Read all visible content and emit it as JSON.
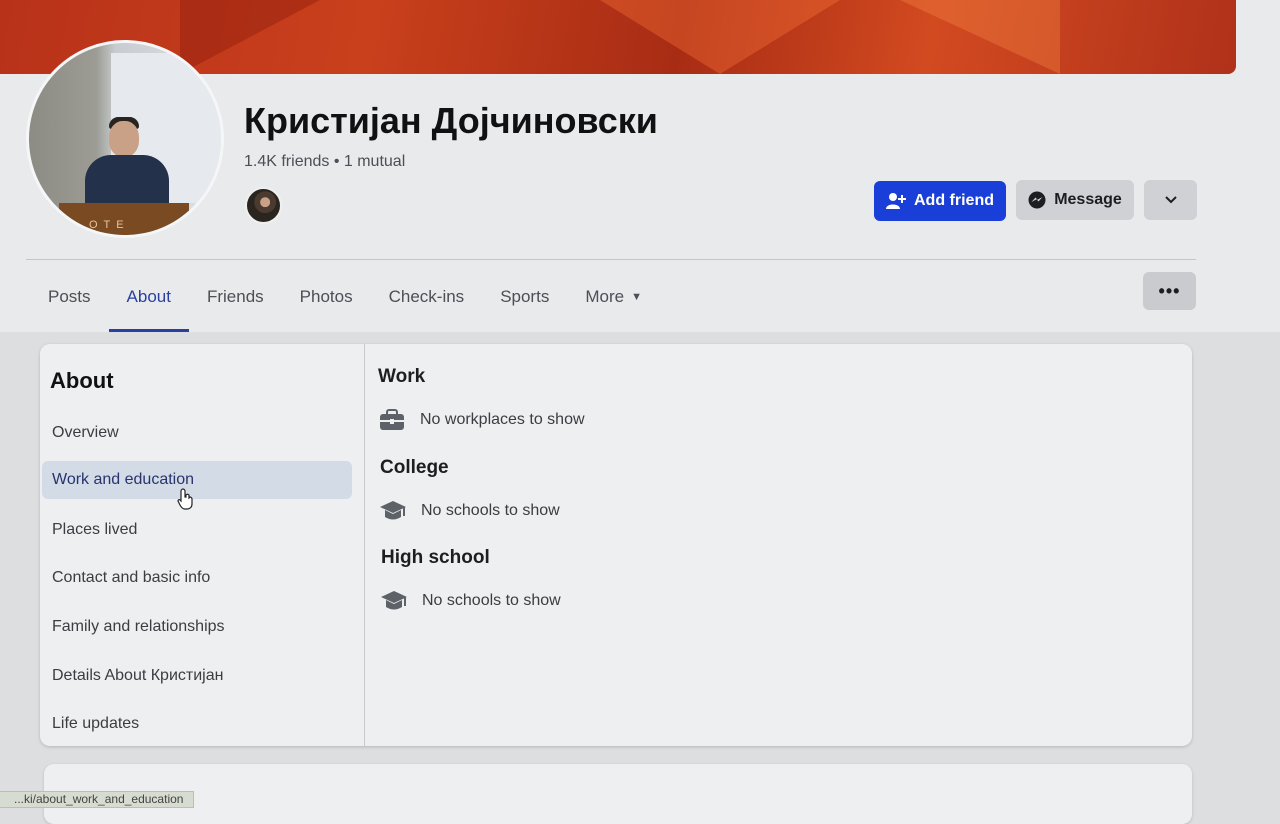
{
  "profile": {
    "name": "Кристијан Дојчиновски",
    "friends_line": "1.4K friends • 1 mutual",
    "podium_text": "OTE"
  },
  "actions": {
    "add_friend": "Add friend",
    "message": "Message"
  },
  "tabs": [
    {
      "label": "Posts"
    },
    {
      "label": "About"
    },
    {
      "label": "Friends"
    },
    {
      "label": "Photos"
    },
    {
      "label": "Check-ins"
    },
    {
      "label": "Sports"
    },
    {
      "label": "More"
    }
  ],
  "about": {
    "title": "About",
    "items": [
      {
        "label": "Overview"
      },
      {
        "label": "Work and education"
      },
      {
        "label": "Places lived"
      },
      {
        "label": "Contact and basic info"
      },
      {
        "label": "Family and relationships"
      },
      {
        "label": "Details About Кристијан"
      },
      {
        "label": "Life updates"
      }
    ],
    "active_item": "Work and education"
  },
  "content": {
    "work": {
      "title": "Work",
      "empty": "No workplaces to show"
    },
    "college": {
      "title": "College",
      "empty": "No schools to show"
    },
    "high_school": {
      "title": "High school",
      "empty": "No schools to show"
    }
  },
  "status_bar": {
    "url": "...ki/about_work_and_education"
  },
  "colors": {
    "primary_button": "#1a3fd9",
    "active_tab": "#2b3fa0",
    "cover": "#b8321a"
  }
}
